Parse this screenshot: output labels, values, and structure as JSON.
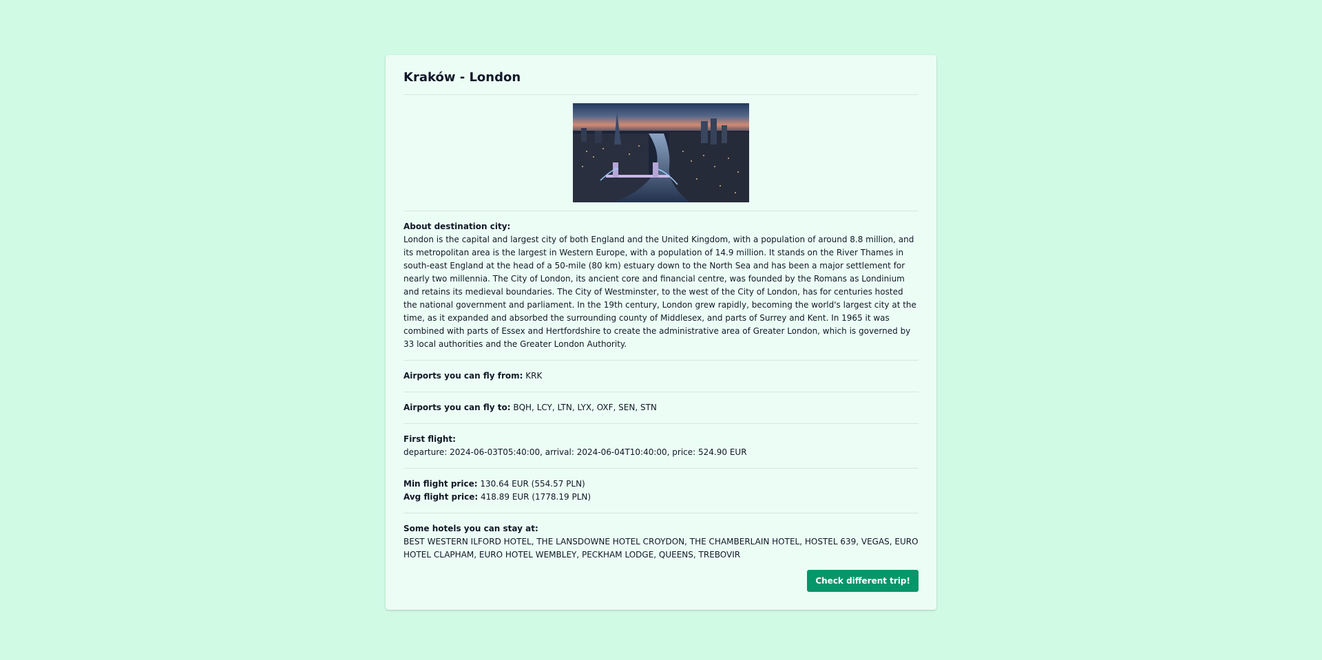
{
  "card": {
    "title": "Kraków - London",
    "image_alt": "Aerial view of London at dusk with Tower Bridge and the River Thames",
    "about": {
      "label": "About destination city:",
      "text": "London is the capital and largest city of both England and the United Kingdom, with a population of around 8.8 million, and its metropolitan area is the largest in Western Europe, with a population of 14.9 million. It stands on the River Thames in south-east England at the head of a 50-mile (80 km) estuary down to the North Sea and has been a major settlement for nearly two millennia. The City of London, its ancient core and financial centre, was founded by the Romans as Londinium and retains its medieval boundaries. The City of Westminster, to the west of the City of London, has for centuries hosted the national government and parliament. In the 19th century, London grew rapidly, becoming the world's largest city at the time, as it expanded and absorbed the surrounding county of Middlesex, and parts of Surrey and Kent. In 1965 it was combined with parts of Essex and Hertfordshire to create the administrative area of Greater London, which is governed by 33 local authorities and the Greater London Authority."
    },
    "airports_from": {
      "label": "Airports you can fly from:",
      "value": "KRK"
    },
    "airports_to": {
      "label": "Airports you can fly to:",
      "value": "BQH, LCY, LTN, LYX, OXF, SEN, STN"
    },
    "first_flight": {
      "label": "First flight:",
      "value": "departure: 2024-06-03T05:40:00, arrival: 2024-06-04T10:40:00, price: 524.90 EUR"
    },
    "min_price": {
      "label": "Min flight price:",
      "value": "130.64 EUR (554.57 PLN)"
    },
    "avg_price": {
      "label": "Avg flight price:",
      "value": "418.89 EUR (1778.19 PLN)"
    },
    "hotels": {
      "label": "Some hotels you can stay at:",
      "value": "BEST WESTERN ILFORD HOTEL, THE LANSDOWNE HOTEL CROYDON, THE CHAMBERLAIN HOTEL, HOSTEL 639, VEGAS, EURO HOTEL CLAPHAM, EURO HOTEL WEMBLEY, PECKHAM LODGE, QUEENS, TREBOVIR"
    },
    "button_label": "Check different trip!"
  },
  "colors": {
    "background": "#d1fae5",
    "card": "#ecfdf5",
    "accent": "#059669"
  }
}
